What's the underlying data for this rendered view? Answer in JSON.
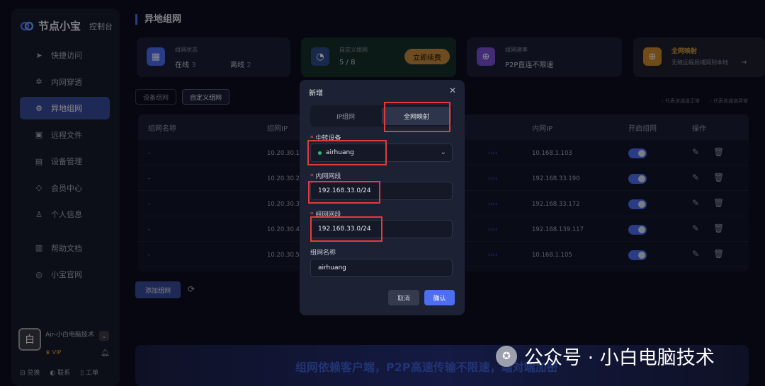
{
  "sidebar": {
    "logo_text": "节点小宝",
    "logo_sub": "控制台",
    "items": [
      {
        "label": "快捷访问",
        "icon": "send-icon"
      },
      {
        "label": "内网穿透",
        "icon": "network-icon"
      },
      {
        "label": "异地组网",
        "icon": "hub-icon"
      },
      {
        "label": "远程文件",
        "icon": "folder-icon"
      },
      {
        "label": "设备管理",
        "icon": "device-icon"
      },
      {
        "label": "会员中心",
        "icon": "diamond-icon"
      },
      {
        "label": "个人信息",
        "icon": "user-icon"
      },
      {
        "label": "帮助文档",
        "icon": "book-icon"
      },
      {
        "label": "小宝官网",
        "icon": "globe-icon"
      }
    ],
    "active_index": 2,
    "user": {
      "avatar_char": "白",
      "name": "Air-小白电脑技术",
      "vip": "VIP"
    },
    "footer": {
      "exchange": "兑换",
      "contact": "联系",
      "ticket": "工单"
    }
  },
  "header": {
    "title": "异地组网"
  },
  "cards": {
    "status": {
      "title": "组网状态",
      "online_label": "在线",
      "online": "3",
      "offline_label": "离线",
      "offline": "2"
    },
    "custom": {
      "title": "自定义组网",
      "value": "5 / 8",
      "renew": "立即续费"
    },
    "speed": {
      "title": "组网速率",
      "value": "P2P直连不限速"
    },
    "mapping": {
      "title": "全网映射",
      "desc": "无缝远程局域网到本地"
    }
  },
  "tabs": [
    "设备组网",
    "自定义组网"
  ],
  "legend": [
    "代表该通道正常",
    "代表该通道异常"
  ],
  "table": {
    "headers": [
      "组网名称",
      "组网IP",
      "内网IP",
      "开启组网",
      "操作"
    ],
    "rows": [
      {
        "name": "-",
        "ip": "10.20.30.1",
        "lan": "10.168.1.103"
      },
      {
        "name": "-",
        "ip": "10.20.30.2",
        "lan": "192.168.33.190"
      },
      {
        "name": "-",
        "ip": "10.20.30.3",
        "lan": "192.168.33.172"
      },
      {
        "name": "-",
        "ip": "10.20.30.4",
        "lan": "192.168.139.117"
      },
      {
        "name": "-",
        "ip": "10.20.30.5",
        "lan": "10.168.1.105"
      }
    ]
  },
  "add_button": "添加组网",
  "banner": "组网依赖客户端，P2P高速传输不限速，端对端加密",
  "watermark": "公众号 · 小白电脑技术",
  "modal": {
    "title": "新增",
    "seg_left": "IP组网",
    "seg_right": "全网映射",
    "relay_label": "中转设备",
    "relay_value": "airhuang",
    "lan_label": "内网网段",
    "lan_value": "192.168.33.0/24",
    "net_label": "组网网段",
    "net_value": "192.168.33.0/24",
    "name_label": "组网名称",
    "name_value": "airhuang",
    "cancel": "取消",
    "confirm": "确认"
  },
  "colors": {
    "accent": "#4e6ef2",
    "annotation": "#e23b3b",
    "vip": "#e0a33a"
  }
}
